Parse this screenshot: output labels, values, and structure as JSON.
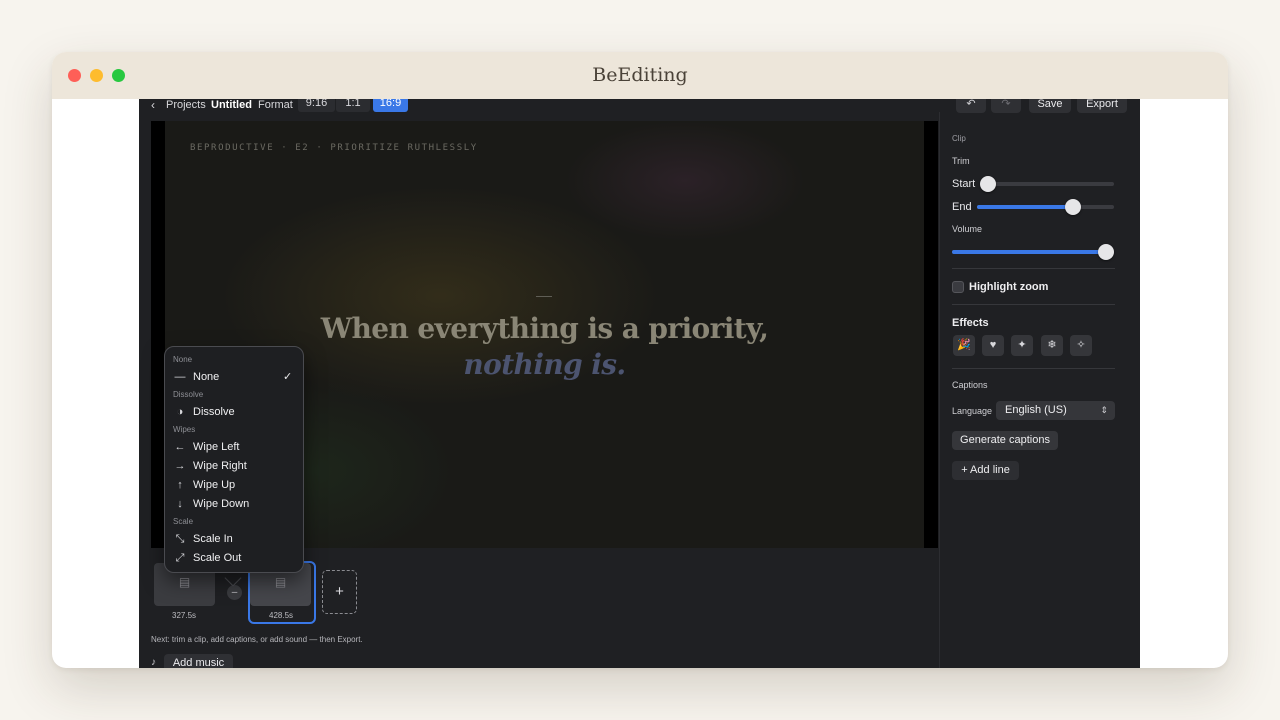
{
  "window": {
    "title": "BeEditing"
  },
  "topbar": {
    "back_icon": "chevron-left-icon",
    "back_glyph": "‹",
    "projects": "Projects",
    "project_name": "Untitled",
    "format_label": "Format",
    "formats": [
      "9:16",
      "1:1",
      "16:9"
    ],
    "selected_format": "16:9",
    "undo_glyph": "↶",
    "redo_glyph": "↷",
    "save": "Save",
    "export": "Export",
    "accent_color": "#3a78e7"
  },
  "preview": {
    "kicker": "BEPRODUCTIVE · E2 · PRIORITIZE RUTHLESSLY",
    "quote_main": "When everything is a priority, ",
    "quote_emphasis": "nothing is."
  },
  "transition_menu": {
    "sections": {
      "none": "None",
      "dissolve": "Dissolve",
      "wipes": "Wipes",
      "scale": "Scale"
    },
    "items": {
      "none": {
        "label": "None",
        "icon": "—"
      },
      "dissolve": {
        "label": "Dissolve",
        "icon": "◑"
      },
      "wipe_left": {
        "label": "Wipe Left",
        "icon": "←"
      },
      "wipe_right": {
        "label": "Wipe Right",
        "icon": "→"
      },
      "wipe_up": {
        "label": "Wipe Up",
        "icon": "↑"
      },
      "wipe_down": {
        "label": "Wipe Down",
        "icon": "↓"
      },
      "scale_in": {
        "label": "Scale In",
        "icon": "⤡"
      },
      "scale_out": {
        "label": "Scale Out",
        "icon": "⤢"
      }
    },
    "selected": "None",
    "check_glyph": "✓"
  },
  "timeline": {
    "clips": [
      {
        "duration": "327.5s",
        "selected": false
      },
      {
        "duration": "428.5s",
        "selected": true
      }
    ],
    "clip_icon": "▤",
    "transition_glyph": "–",
    "add_glyph": "+"
  },
  "footer": {
    "hint": "Next: trim a clip, add captions, or add sound — then Export.",
    "music_icon": "♪",
    "add_music": "Add music"
  },
  "panel": {
    "section_clip": "Clip",
    "trim_label": "Trim",
    "start_label": "Start",
    "end_label": "End",
    "volume_label": "Volume",
    "trim_start_fraction": 0.0,
    "trim_end_fraction": 0.7,
    "volume_fraction": 1.0,
    "highlight_zoom": "Highlight zoom",
    "highlight_zoom_checked": false,
    "effects_label": "Effects",
    "effects": [
      {
        "icon": "party-popper-icon",
        "glyph": "🎉"
      },
      {
        "icon": "heart-icon",
        "glyph": "♥"
      },
      {
        "icon": "sparkle-icon",
        "glyph": "✦"
      },
      {
        "icon": "snowflake-icon",
        "glyph": "❄"
      },
      {
        "icon": "sparkles-icon",
        "glyph": "✧"
      }
    ],
    "captions_label": "Captions",
    "language_label": "Language",
    "language_value": "English (US)",
    "language_chevron": "⇕",
    "generate_captions": "Generate captions",
    "add_line": "+ Add line"
  }
}
